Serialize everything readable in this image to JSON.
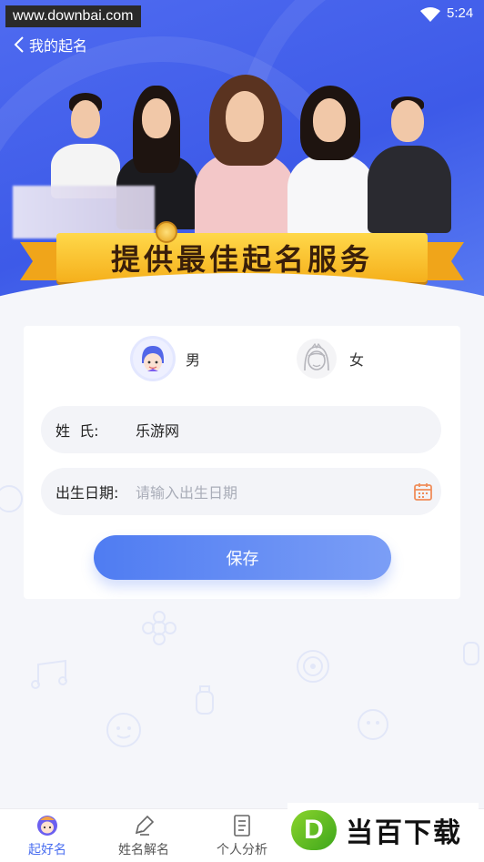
{
  "statusbar": {
    "watermark": "www.downbai.com",
    "time": "5:24"
  },
  "header": {
    "back_label": "我的起名"
  },
  "banner": {
    "slogan": "提供最佳起名服务"
  },
  "form": {
    "gender_options": [
      {
        "label": "男",
        "icon": "boy-avatar-icon",
        "selected": true
      },
      {
        "label": "女",
        "icon": "girl-avatar-icon",
        "selected": false
      }
    ],
    "surname_label": "姓  氏:",
    "surname_value": "乐游网",
    "birthdate_label": "出生日期:",
    "birthdate_placeholder": "请输入出生日期",
    "save_label": "保存"
  },
  "tabs": [
    {
      "label": "起好名",
      "icon": "baby-face-icon",
      "active": true
    },
    {
      "label": "姓名解名",
      "icon": "pen-icon",
      "active": false
    },
    {
      "label": "个人分析",
      "icon": "document-icon",
      "active": false
    }
  ],
  "watermark_logo": {
    "letter": "D",
    "text": "当百下载"
  },
  "colors": {
    "primary": "#4a6ef0",
    "banner_gold": "#f5b01c",
    "background": "#f5f6fa"
  }
}
